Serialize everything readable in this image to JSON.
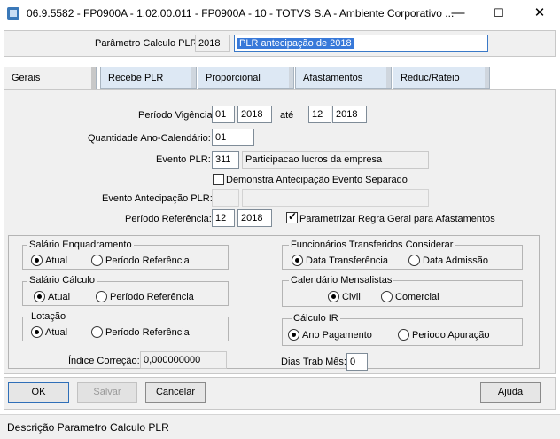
{
  "window": {
    "title": "06.9.5582 - FP0900A - 1.02.00.011 - FP0900A - 10 - TOTVS S.A - Ambiente Corporativo ...",
    "minimize": "—",
    "maximize": "☐",
    "close": "✕"
  },
  "header": {
    "label": "Parâmetro Calculo PLR:",
    "code": "2018",
    "description": "PLR antecipação de 2018"
  },
  "tabs": [
    "Gerais",
    "Recebe PLR",
    "Proporcional",
    "Afastamentos",
    "Reduc/Rateio"
  ],
  "general": {
    "periodo_vigencia_label": "Período Vigência:",
    "vig_start_month": "01",
    "vig_start_year": "2018",
    "ate_label": "até",
    "vig_end_month": "12",
    "vig_end_year": "2018",
    "quantidade_label": "Quantidade Ano-Calendário:",
    "quantidade_value": "01",
    "evento_label": "Evento PLR:",
    "evento_code": "311",
    "evento_desc": "Participacao lucros da empresa",
    "demonstra_label": "Demonstra Antecipação Evento Separado",
    "demonstra_checked": false,
    "evento_antecipacao_label": "Evento Antecipação PLR:",
    "periodo_ref_label": "Período Referência:",
    "ref_month": "12",
    "ref_year": "2018",
    "parametrizar_label": "Parametrizar Regra Geral para Afastamentos",
    "parametrizar_checked": true
  },
  "groups": {
    "salario_enquadramento": {
      "title": "Salário Enquadramento",
      "options": [
        "Atual",
        "Período Referência"
      ],
      "selected": 0
    },
    "salario_calculo": {
      "title": "Salário Cálculo",
      "options": [
        "Atual",
        "Período Referência"
      ],
      "selected": 0
    },
    "lotacao": {
      "title": "Lotação",
      "options": [
        "Atual",
        "Período Referência"
      ],
      "selected": 0
    },
    "funcionarios_transferidos": {
      "title": "Funcionários Transferidos Considerar",
      "options": [
        "Data Transferência",
        "Data Admissão"
      ],
      "selected": 0
    },
    "calendario_mensalistas": {
      "title": "Calendário Mensalistas",
      "options": [
        "Civil",
        "Comercial"
      ],
      "selected": 0
    },
    "calculo_ir": {
      "title": "Cálculo IR",
      "options": [
        "Ano Pagamento",
        "Periodo Apuração"
      ],
      "selected": 0
    }
  },
  "indice": {
    "label": "Índice Correção:",
    "value": "0,000000000"
  },
  "dias_trab": {
    "label": "Dias Trab Mês:",
    "value": "0"
  },
  "buttons": {
    "ok": "OK",
    "salvar": "Salvar",
    "cancelar": "Cancelar",
    "ajuda": "Ajuda"
  },
  "status": "Descrição Parametro Calculo PLR"
}
